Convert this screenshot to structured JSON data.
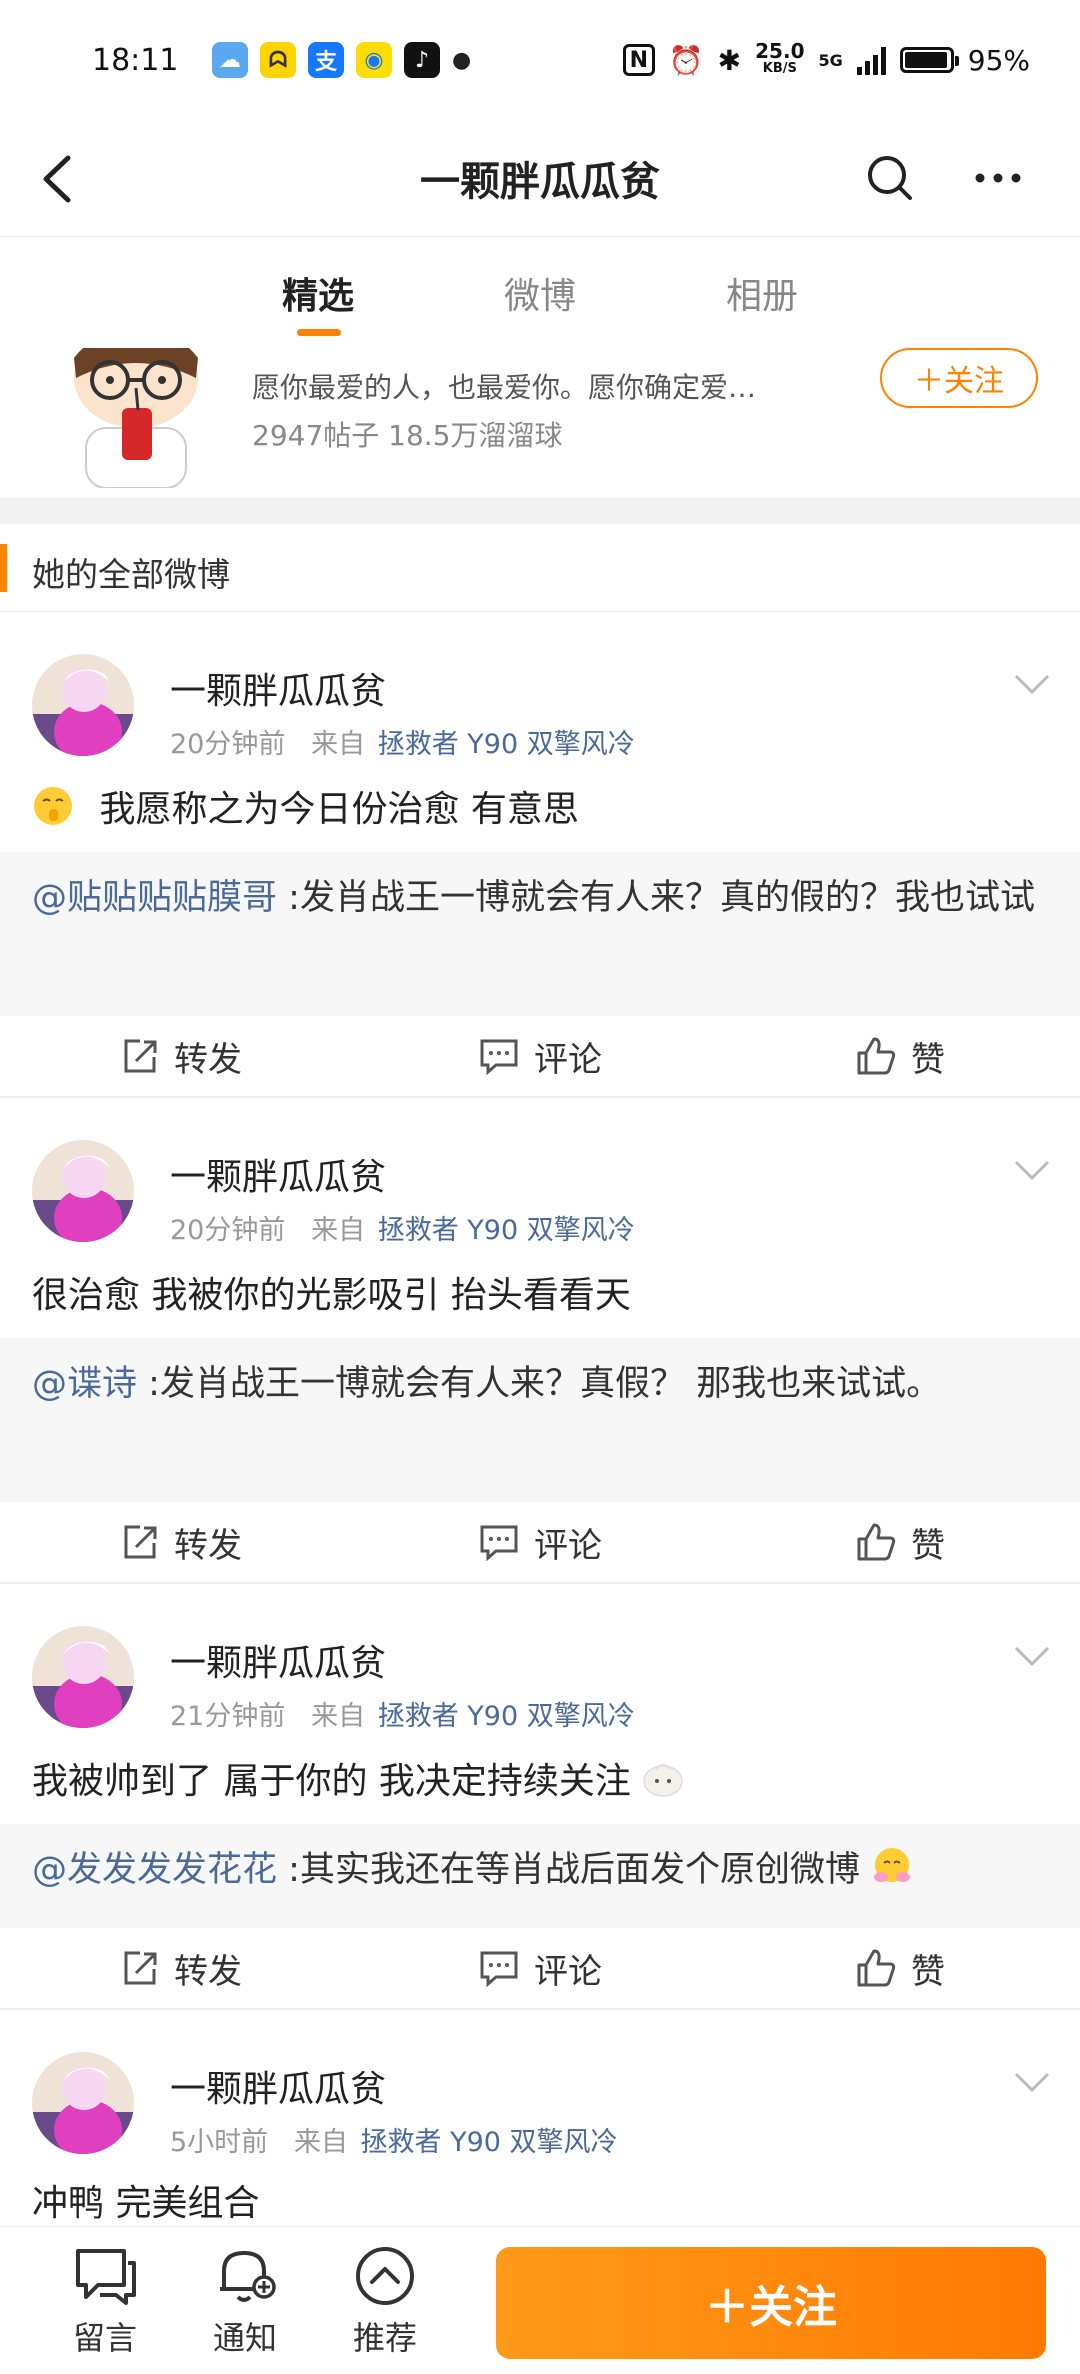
{
  "status_bar": {
    "time": "18:11",
    "network_speed_value": "25.0",
    "network_speed_unit": "KB/S",
    "network_type": "5G",
    "battery": "95%",
    "battery_level": 0.95
  },
  "nav": {
    "title": "一颗胖瓜瓜贫"
  },
  "tabs": [
    {
      "label": "精选",
      "active": true
    },
    {
      "label": "微博",
      "active": false
    },
    {
      "label": "相册",
      "active": false
    }
  ],
  "profile": {
    "bio": "愿你最爱的人，也最爱你。愿你确定爱…",
    "stats": "2947帖子  18.5万溜溜球",
    "follow_label": "＋关注"
  },
  "section": {
    "title": "她的全部微博"
  },
  "posts": [
    {
      "name": "一颗胖瓜瓜贫",
      "time": "20分钟前",
      "from": "来自",
      "source": "拯救者 Y90 双擎风冷",
      "text": "我愿称之为今日份治愈  有意思",
      "lead_emoji": "shush-face-emoji",
      "repost_user": "@贴贴贴贴膜哥",
      "repost_text": ":发肖战王一博就会有人来？真的假的？我也试试"
    },
    {
      "name": "一颗胖瓜瓜贫",
      "time": "20分钟前",
      "from": "来自",
      "source": "拯救者 Y90 双擎风冷",
      "text": "很治愈  我被你的光影吸引  抬头看看天",
      "repost_user": "@谍诗",
      "repost_text": ":发肖战王一博就会有人来？真假？  那我也来试试。"
    },
    {
      "name": "一颗胖瓜瓜贫",
      "time": "21分钟前",
      "from": "来自",
      "source": "拯救者 Y90 双擎风冷",
      "text": "我被帅到了  属于你的  我决定持续关注",
      "trail_emoji": "bun-face-emoji",
      "repost_user": "@发发发发花花",
      "repost_text": ":其实我还在等肖战后面发个原创微博",
      "repost_emoji": "hugging-face-emoji"
    },
    {
      "name": "一颗胖瓜瓜贫",
      "time": "5小时前",
      "from": "来自",
      "source": "拯救者 Y90 双擎风冷",
      "text": "冲鸭  完美组合"
    }
  ],
  "actions": {
    "repost": "转发",
    "comment": "评论",
    "like": "赞"
  },
  "bottom_bar": {
    "message": "留言",
    "notify": "通知",
    "recommend": "推荐",
    "follow": "＋关注"
  },
  "colors": {
    "accent": "#ff8200",
    "link": "#4a6a9c"
  }
}
